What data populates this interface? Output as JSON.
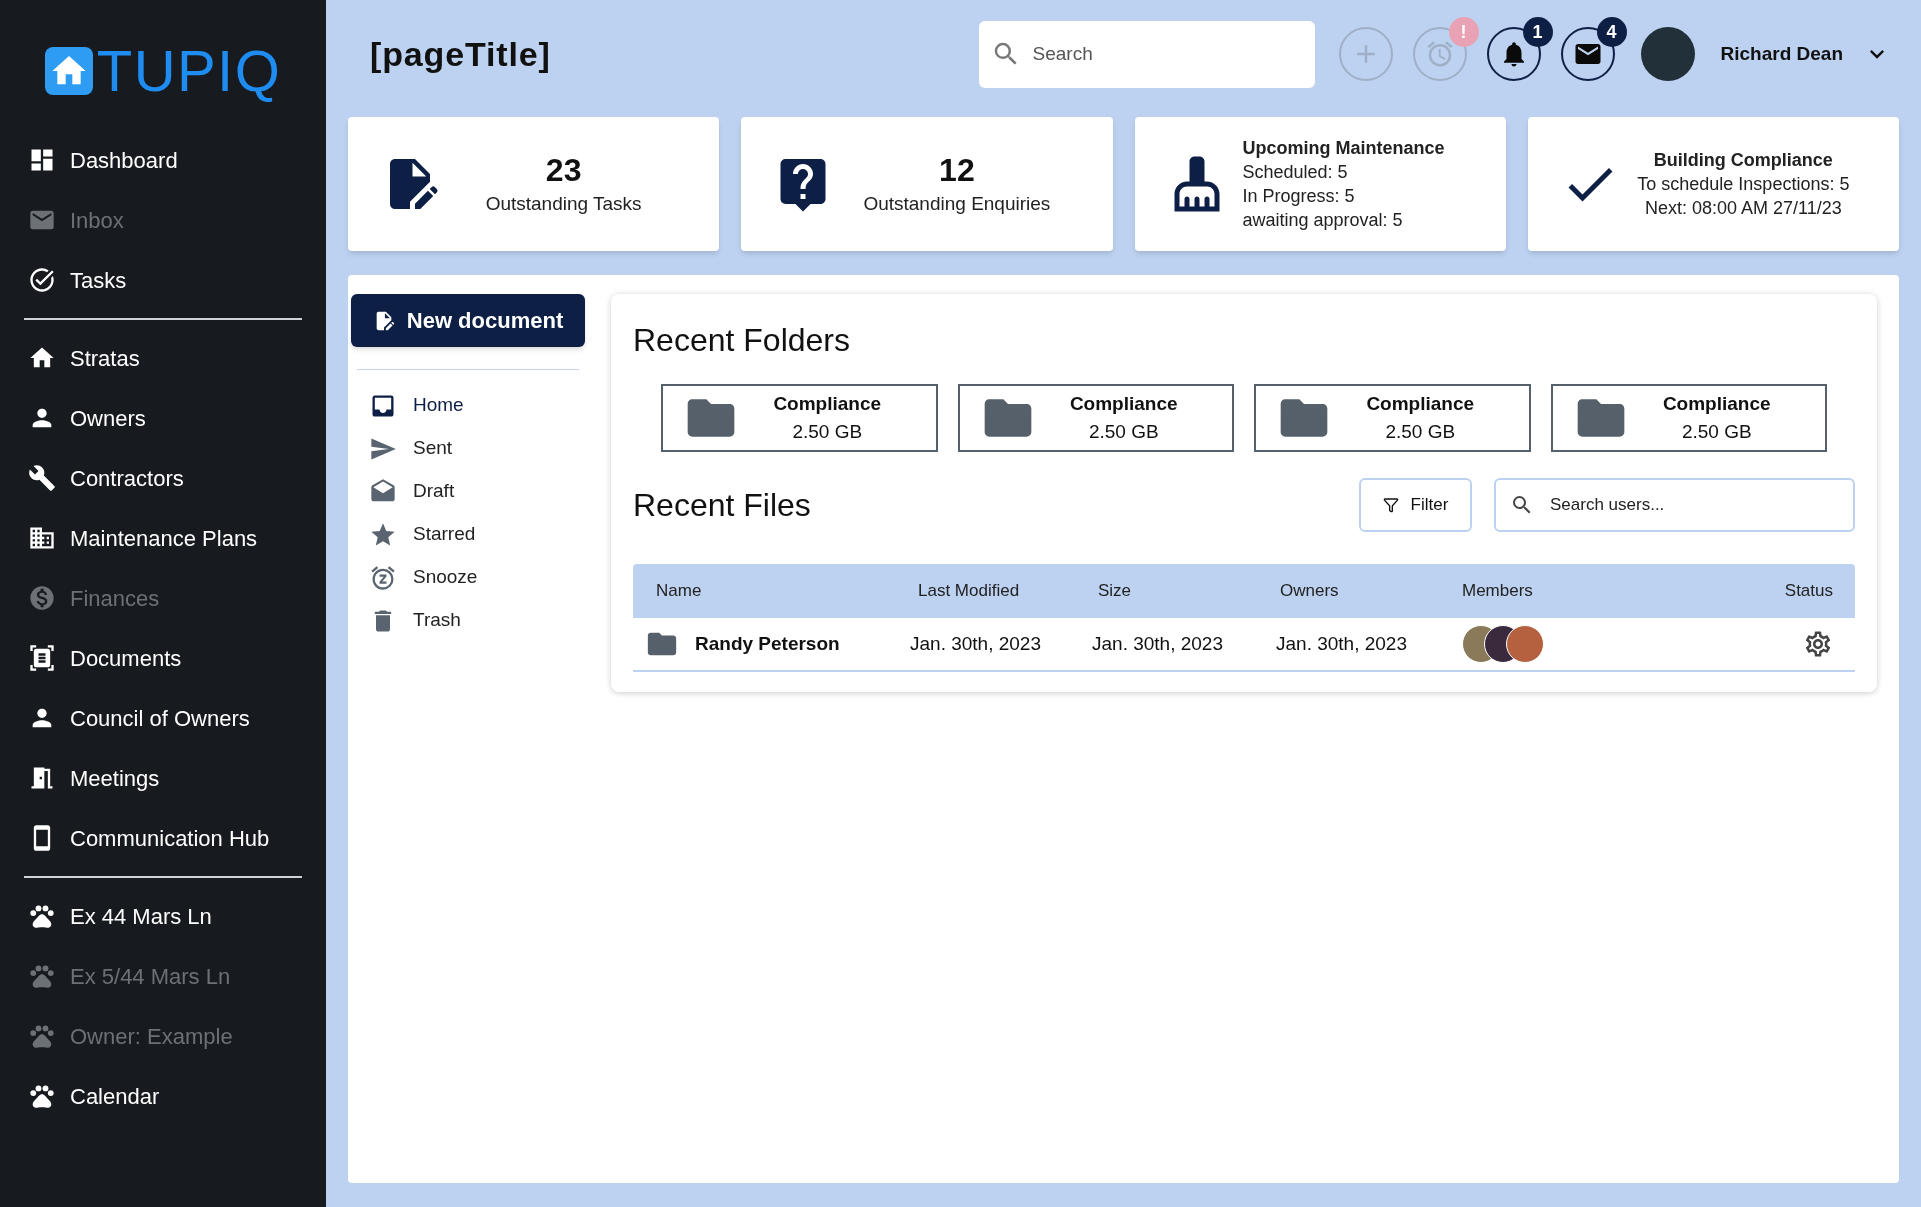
{
  "logo": {
    "text": "TUPIQ"
  },
  "sidebar": {
    "groups": [
      [
        {
          "label": "Dashboard",
          "disabled": false
        },
        {
          "label": "Inbox",
          "disabled": true
        },
        {
          "label": "Tasks",
          "disabled": false
        }
      ],
      [
        {
          "label": "Stratas",
          "disabled": false
        },
        {
          "label": "Owners",
          "disabled": false
        },
        {
          "label": "Contractors",
          "disabled": false
        },
        {
          "label": "Maintenance Plans",
          "disabled": false
        },
        {
          "label": "Finances",
          "disabled": true
        },
        {
          "label": "Documents",
          "disabled": false
        },
        {
          "label": "Council of Owners",
          "disabled": false
        },
        {
          "label": "Meetings",
          "disabled": false
        },
        {
          "label": "Communication Hub",
          "disabled": false
        }
      ],
      [
        {
          "label": "Ex 44 Mars Ln",
          "disabled": false
        },
        {
          "label": "Ex 5/44 Mars Ln",
          "disabled": true
        },
        {
          "label": "Owner: Example",
          "disabled": true
        },
        {
          "label": "Calendar",
          "disabled": false
        }
      ]
    ]
  },
  "header": {
    "title": "[pageTitle]",
    "search": {
      "placeholder": "Search"
    },
    "actions": [
      {
        "kind": "add",
        "disabled": true
      },
      {
        "kind": "alarm",
        "disabled": true,
        "badge": "!"
      },
      {
        "kind": "notifications",
        "disabled": false,
        "badge": "1"
      },
      {
        "kind": "messages",
        "disabled": false,
        "badge": "4"
      }
    ],
    "user": {
      "name": "Richard Dean"
    }
  },
  "stats": [
    {
      "kind": "count",
      "value": "23",
      "label": "Outstanding Tasks"
    },
    {
      "kind": "count",
      "value": "12",
      "label": "Outstanding Enquiries"
    },
    {
      "kind": "detail",
      "title": "Upcoming Maintenance",
      "lines": [
        "Scheduled: 5",
        "In Progress: 5",
        "awaiting approval: 5"
      ]
    },
    {
      "kind": "centered",
      "title": "Building Compliance",
      "lines": [
        "To schedule Inspections: 5",
        "Next: 08:00 AM 27/11/23"
      ]
    }
  ],
  "documents": {
    "new_button": "New document",
    "nav": [
      {
        "label": "Home",
        "selected": true
      },
      {
        "label": "Sent",
        "selected": false
      },
      {
        "label": "Draft",
        "selected": false
      },
      {
        "label": "Starred",
        "selected": false
      },
      {
        "label": "Snooze",
        "selected": false
      },
      {
        "label": "Trash",
        "selected": false
      }
    ],
    "recent_folders": {
      "title": "Recent Folders",
      "items": [
        {
          "name": "Compliance",
          "size": "2.50 GB"
        },
        {
          "name": "Compliance",
          "size": "2.50 GB"
        },
        {
          "name": "Compliance",
          "size": "2.50 GB"
        },
        {
          "name": "Compliance",
          "size": "2.50 GB"
        }
      ]
    },
    "recent_files": {
      "title": "Recent Files",
      "filter": "Filter",
      "search": {
        "placeholder": "Search users..."
      },
      "columns": [
        "Name",
        "Last Modified",
        "Size",
        "Owners",
        "Members",
        "Status"
      ],
      "rows": [
        {
          "name": "Randy Peterson",
          "last_modified": "Jan. 30th, 2023",
          "size": "Jan. 30th, 2023",
          "owners": "Jan. 30th, 2023"
        }
      ]
    }
  }
}
